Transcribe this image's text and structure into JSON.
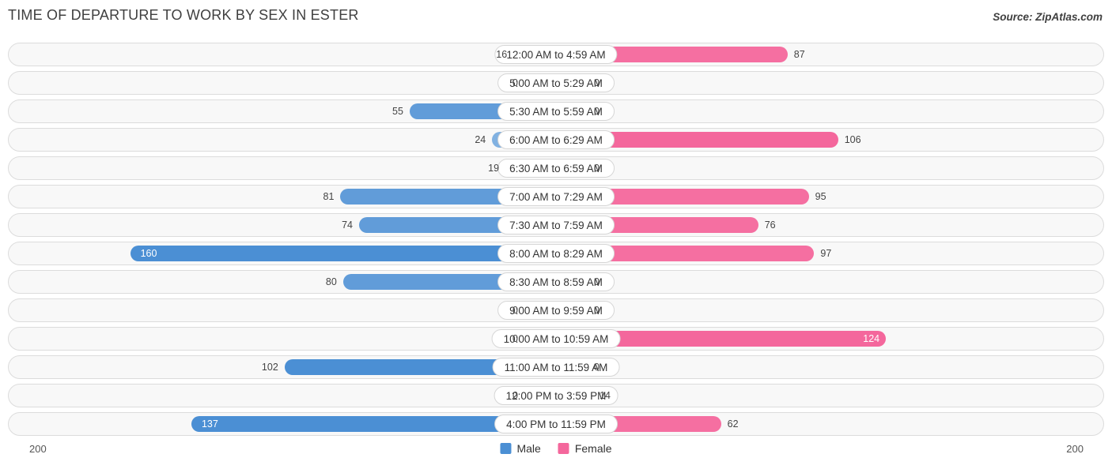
{
  "header": {
    "title": "Time of Departure to Work by Sex in Ester",
    "source": "Source: ZipAtlas.com"
  },
  "axis": {
    "left_label": "200",
    "right_label": "200"
  },
  "legend": {
    "items": [
      {
        "label": "Male",
        "color": "#4b8fd4"
      },
      {
        "label": "Female",
        "color": "#f4679c"
      }
    ]
  },
  "chart_data": {
    "type": "bar",
    "title": "Time of Departure to Work by Sex in Ester",
    "subtitle": "Source: ZipAtlas.com",
    "orientation": "horizontal-diverging",
    "xlabel": "",
    "ylabel": "",
    "xlim": [
      -200,
      200
    ],
    "axis_tick_labels": [
      "200",
      "200"
    ],
    "grid": false,
    "legend_position": "bottom-center",
    "categories": [
      "12:00 AM to 4:59 AM",
      "5:00 AM to 5:29 AM",
      "5:30 AM to 5:59 AM",
      "6:00 AM to 6:29 AM",
      "6:30 AM to 6:59 AM",
      "7:00 AM to 7:29 AM",
      "7:30 AM to 7:59 AM",
      "8:00 AM to 8:29 AM",
      "8:30 AM to 8:59 AM",
      "9:00 AM to 9:59 AM",
      "10:00 AM to 10:59 AM",
      "11:00 AM to 11:59 AM",
      "12:00 PM to 3:59 PM",
      "4:00 PM to 11:59 PM"
    ],
    "series": [
      {
        "name": "Male",
        "color": "#4b8fd4",
        "values": [
          16,
          0,
          55,
          24,
          19,
          81,
          74,
          160,
          80,
          0,
          0,
          102,
          0,
          137
        ]
      },
      {
        "name": "Female",
        "color": "#f4679c",
        "values": [
          87,
          0,
          0,
          106,
          0,
          95,
          76,
          97,
          0,
          0,
          124,
          0,
          14,
          62
        ]
      }
    ]
  }
}
